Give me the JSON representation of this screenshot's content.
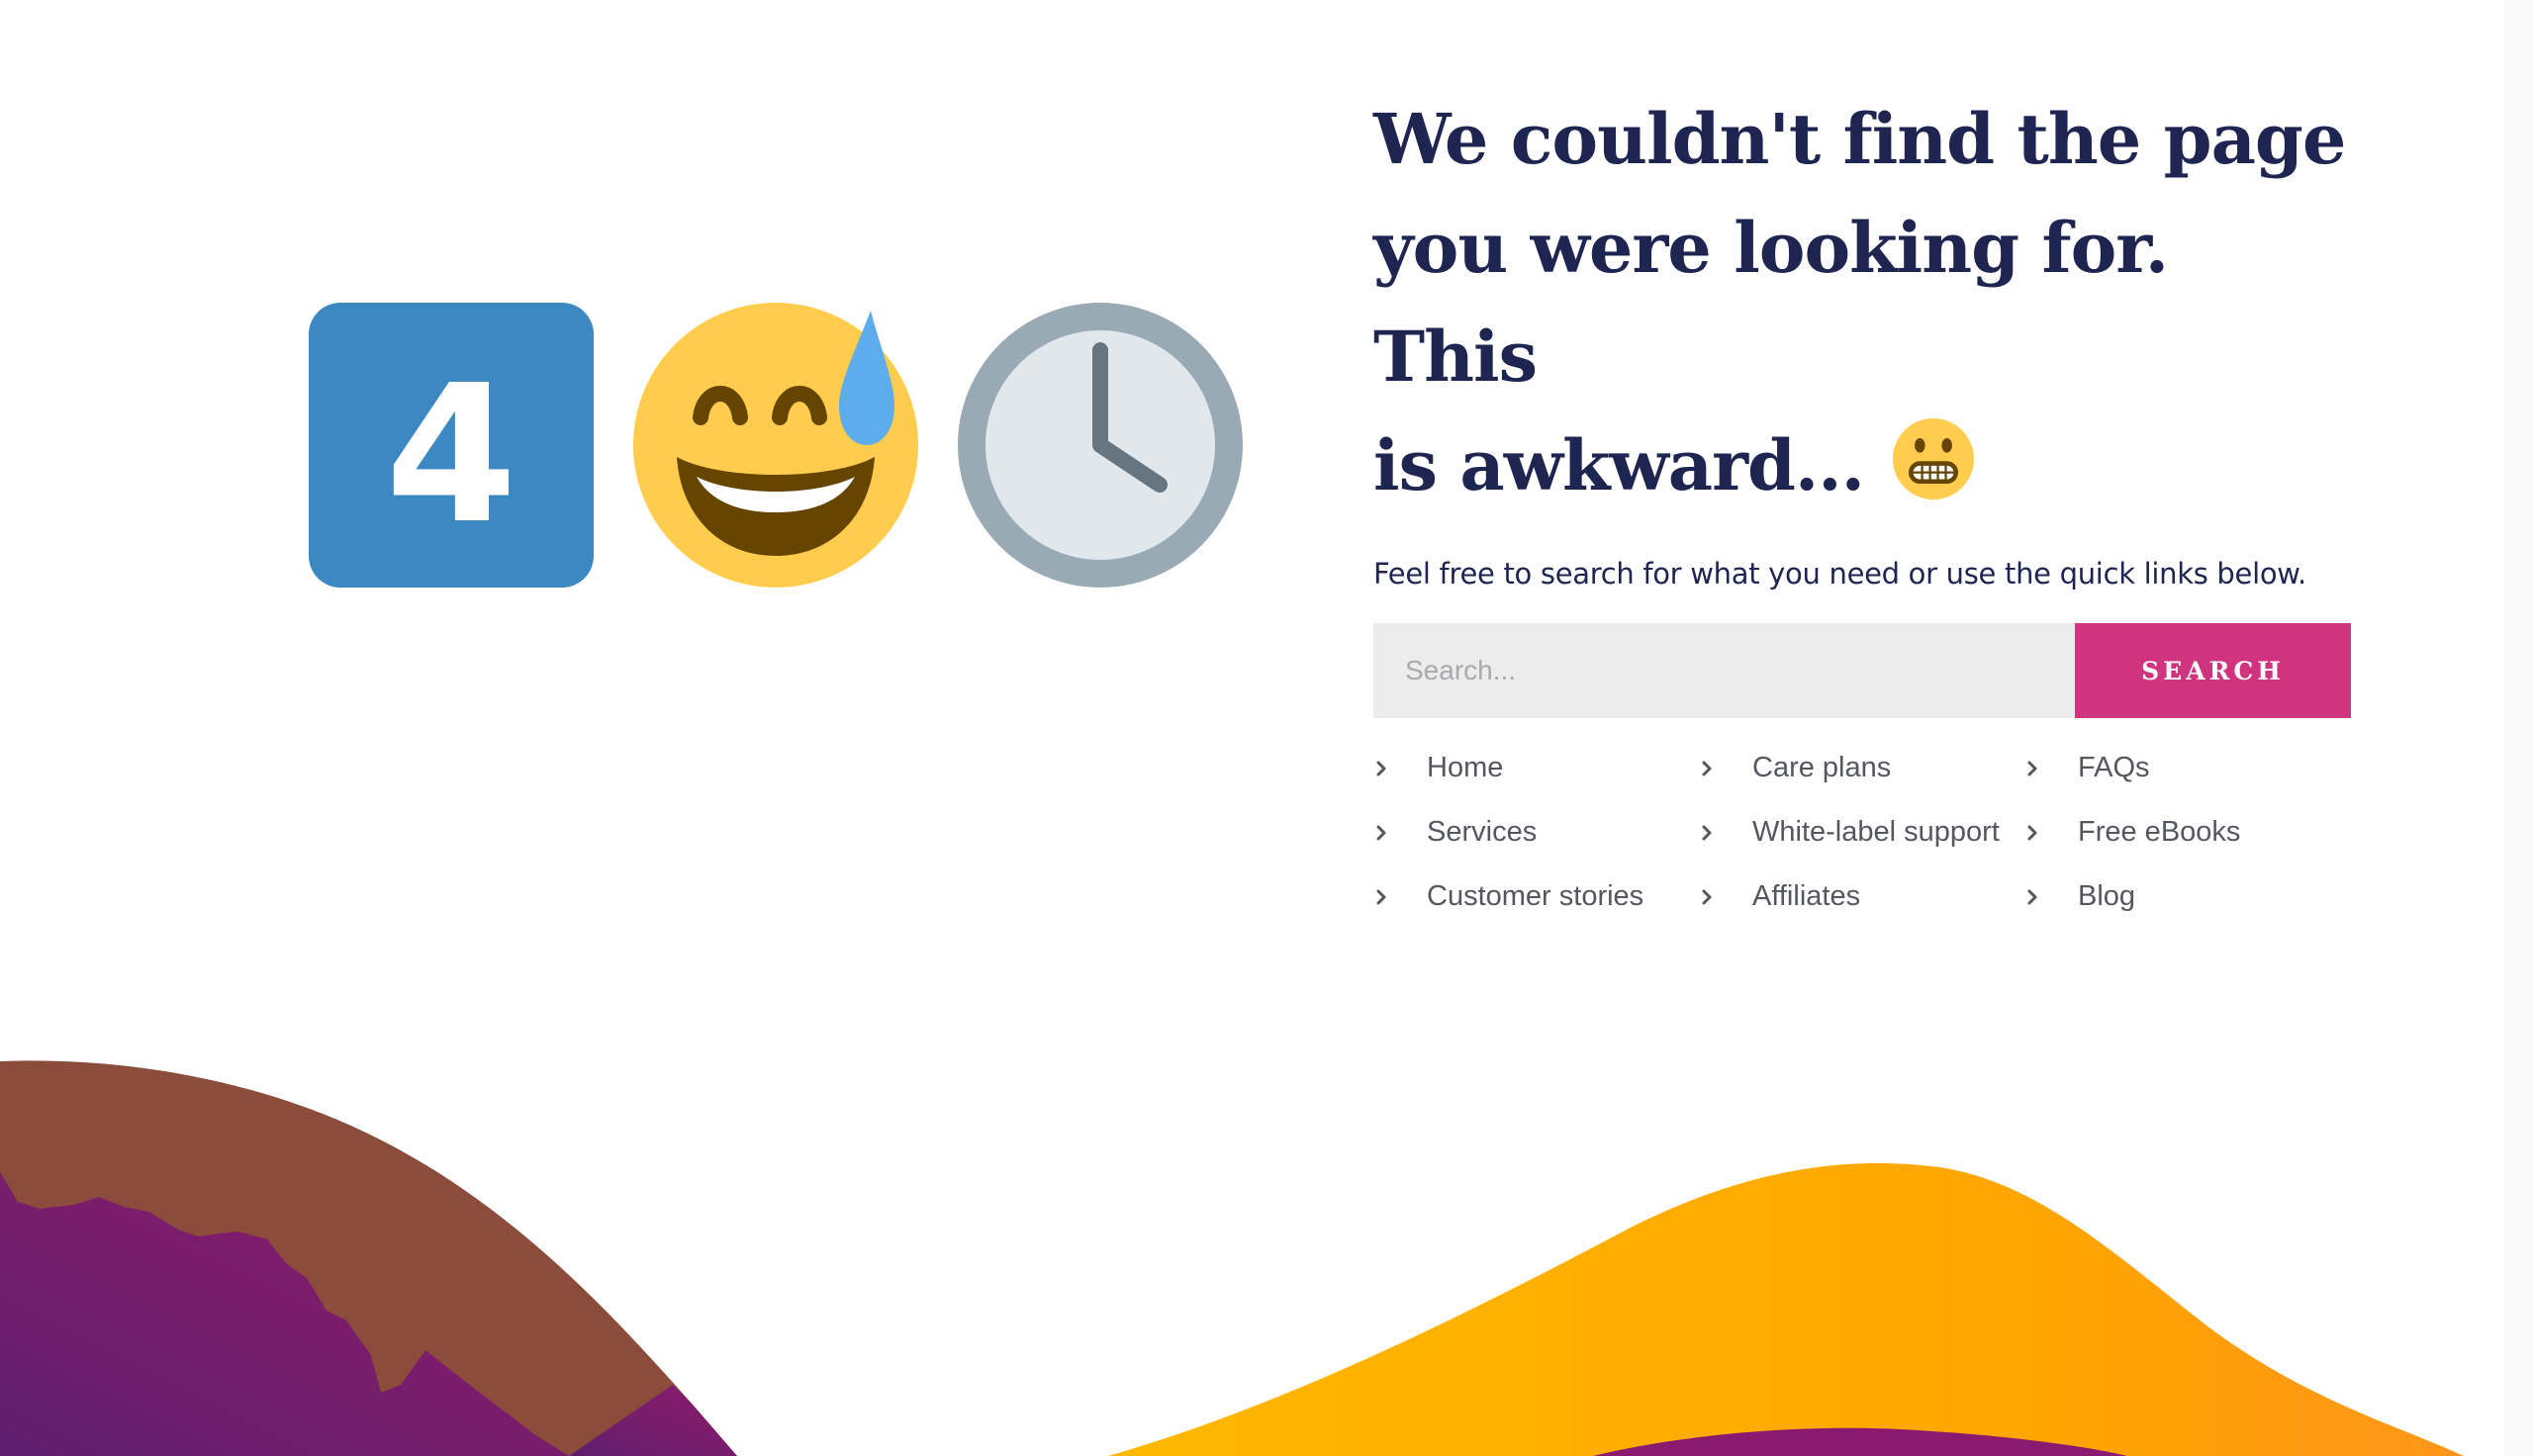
{
  "hero_emojis": [
    {
      "name": "keycap-four",
      "char": "4",
      "bg": "#3b88c3"
    },
    {
      "name": "grinning-face-with-sweat",
      "bg": "#ffcc4d"
    },
    {
      "name": "clock-four-oclock",
      "bg": "#99aab5"
    }
  ],
  "heading": {
    "text": "We couldn't find the page you were looking for. This is awkward...",
    "line1": "We couldn't find the page",
    "line2": "you were looking for. This",
    "line3": "is awkward...",
    "trailing_emoji": "grimacing-face"
  },
  "subtitle": "Feel free to search for what you need or use the quick links below.",
  "search": {
    "placeholder": "Search...",
    "value": "",
    "button_label": "SEARCH"
  },
  "quick_links": [
    {
      "label": "Home"
    },
    {
      "label": "Care plans"
    },
    {
      "label": "FAQs"
    },
    {
      "label": "Services"
    },
    {
      "label": "White-label support"
    },
    {
      "label": "Free eBooks"
    },
    {
      "label": "Customer stories"
    },
    {
      "label": "Affiliates"
    },
    {
      "label": "Blog"
    }
  ],
  "colors": {
    "heading": "#1d2550",
    "search_button": "#d1347f",
    "search_input_bg": "#ececec",
    "link_text": "#54575e",
    "wave_brown": "#8b4c3c",
    "wave_purple": "#7e1c6c",
    "wave_orange": "#ffaa00"
  }
}
